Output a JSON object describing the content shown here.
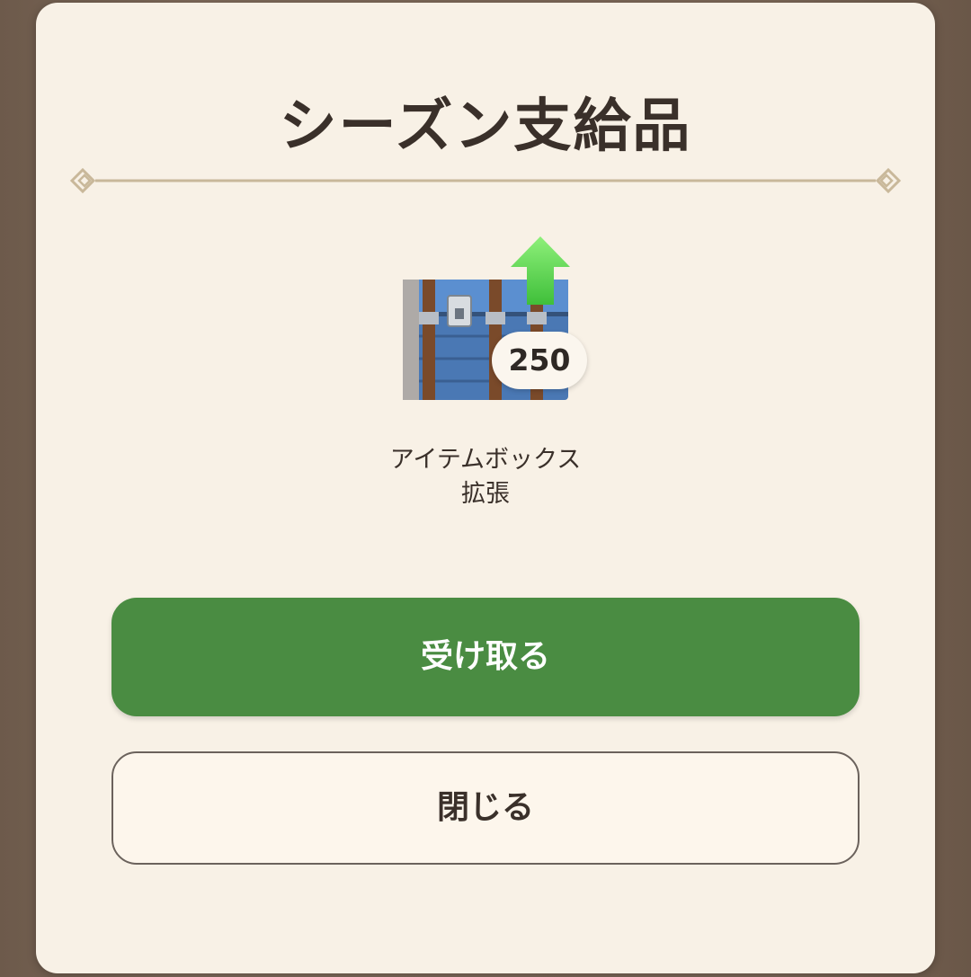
{
  "dialog": {
    "title": "シーズン支給品"
  },
  "reward": {
    "icon": "item-box-chest-upgrade-icon",
    "count": "250",
    "name": "アイテムボックス\n拡張"
  },
  "buttons": {
    "claim_label": "受け取る",
    "close_label": "閉じる"
  },
  "colors": {
    "claim_button": "#4a8c42",
    "panel_background": "#f8f1e6",
    "divider": "#c9b89a"
  }
}
